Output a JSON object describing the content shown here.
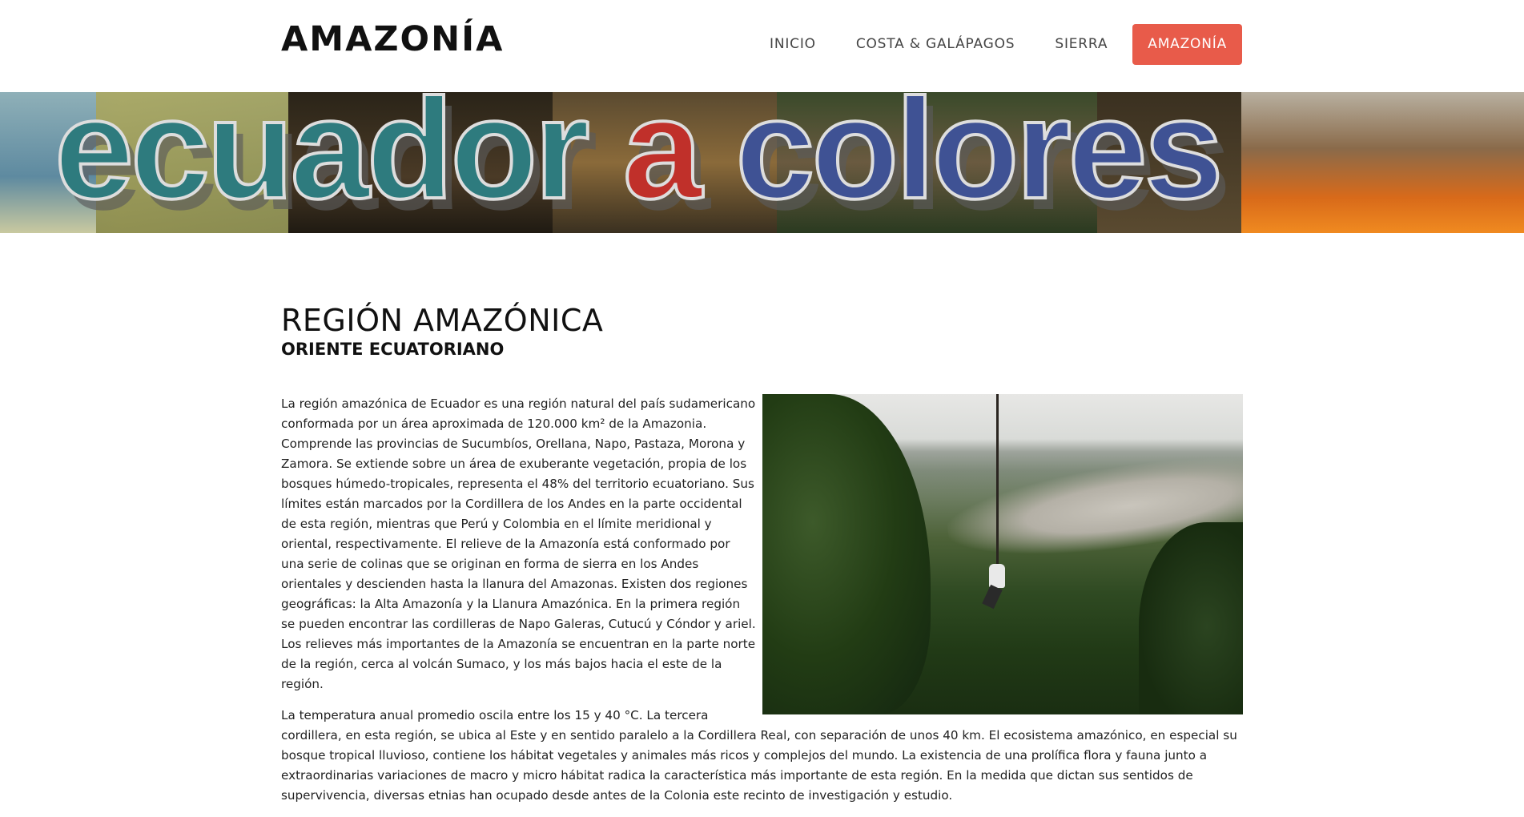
{
  "header": {
    "site_title": "AMAZONÍA",
    "nav": [
      {
        "label": "INICIO",
        "active": false
      },
      {
        "label": "COSTA & GALÁPAGOS",
        "active": false
      },
      {
        "label": "SIERRA",
        "active": false
      },
      {
        "label": "AMAZONÍA",
        "active": true
      }
    ]
  },
  "banner": {
    "word1": "ecuador",
    "word2": "a",
    "word3": "colores"
  },
  "main": {
    "title": "REGIÓN AMAZÓNICA",
    "subtitle": "ORIENTE ECUATORIANO",
    "paragraphs": [
      "La región amazónica de Ecuador es una región natural del país sudamericano conformada por un área aproximada de 120.000 km² de la Amazonia. Comprende las provincias de Sucumbíos, Orellana, Napo, Pastaza, Morona y Zamora. Se extiende sobre un área de exuberante vegetación, propia de los bosques húmedo-tropicales, representa el 48% del territorio ecuatoriano. Sus límites están marcados por la Cordillera de los Andes en la parte occidental de esta región, mientras que Perú y Colombia en el límite meridional y oriental, respectivamente. El relieve de la Amazonía está conformado por una serie de colinas que se originan en forma de sierra en los Andes orientales y descienden hasta la llanura del Amazonas. Existen dos regiones geográficas: la Alta Amazonía y la Llanura Amazónica. En la primera región se pueden encontrar las cordilleras de Napo Galeras, Cutucú y Cóndor y ariel. Los relieves más importantes de la Amazonía se encuentran en la parte norte de la región, cerca al volcán Sumaco, y los más bajos hacia el este de la región.",
      "La temperatura anual promedio oscila entre los 15 y 40 °C. La tercera cordillera, en esta región, se ubica al Este y en sentido paralelo a la Cordillera Real, con separación de unos 40 km. El ecosistema amazónico, en especial su bosque tropical lluvioso, contiene los hábitat vegetales y animales más ricos y complejos del mundo. La existencia de una prolífica flora y fauna junto a extraordinarias variaciones de macro y micro hábitat radica la característica más importante de esta región. En la medida que dictan sus sentidos de supervivencia, diversas etnias han ocupado desde antes de la Colonia este recinto de investigación y estudio."
    ]
  }
}
